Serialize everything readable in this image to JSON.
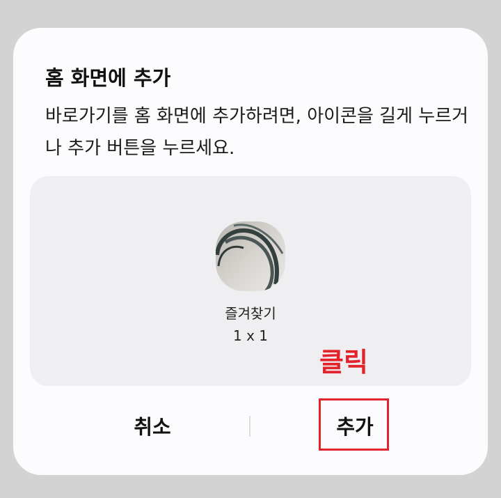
{
  "dialog": {
    "title": "홈 화면에 추가",
    "description": "바로가기를 홈 화면에 추가하려면, 아이콘을 길게 누르거나 추가 버튼을 누르세요."
  },
  "widget": {
    "icon": "bookmark-thumbnail-icon",
    "name": "즐겨찾기",
    "size": "1 x 1"
  },
  "annotation": {
    "label": "클릭",
    "color": "#e3232c"
  },
  "buttons": {
    "cancel_label": "취소",
    "add_label": "추가"
  },
  "colors": {
    "backdrop": "#d3d3d3",
    "dialog_bg": "#fcfcfe",
    "preview_bg": "#efeff1",
    "highlight": "#e3232c"
  }
}
